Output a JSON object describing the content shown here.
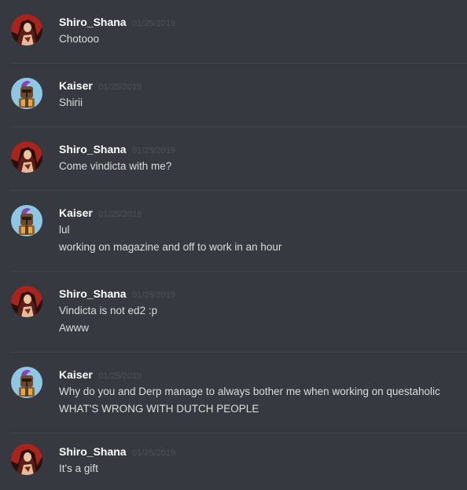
{
  "messages": [
    {
      "author": "Shiro_Shana",
      "timestamp": "01/25/2019",
      "avatar": "shana-avatar",
      "lines": [
        "Chotooo"
      ]
    },
    {
      "author": "Kaiser",
      "timestamp": "01/25/2019",
      "avatar": "knight-avatar",
      "lines": [
        "Shirii"
      ]
    },
    {
      "author": "Shiro_Shana",
      "timestamp": "01/25/2019",
      "avatar": "shana-avatar",
      "lines": [
        "Come vindicta with me?"
      ]
    },
    {
      "author": "Kaiser",
      "timestamp": "01/25/2019",
      "avatar": "knight-avatar",
      "lines": [
        "lul",
        "working on magazine and off to work in an hour"
      ]
    },
    {
      "author": "Shiro_Shana",
      "timestamp": "01/25/2019",
      "avatar": "shana-avatar",
      "lines": [
        "Vindicta is not ed2 :p",
        "Awww"
      ]
    },
    {
      "author": "Kaiser",
      "timestamp": "01/25/2019",
      "avatar": "knight-avatar",
      "lines": [
        "Why do you and Derp manage to always bother me when working on questaholic",
        "WHAT'S WRONG WITH DUTCH PEOPLE"
      ]
    },
    {
      "author": "Shiro_Shana",
      "timestamp": "01/25/2019",
      "avatar": "shana-avatar",
      "lines": [
        "It's a gift"
      ]
    }
  ]
}
